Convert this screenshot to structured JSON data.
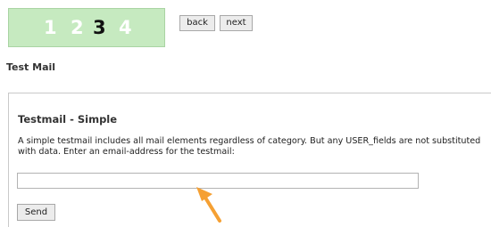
{
  "stepper": {
    "steps": [
      "1",
      "2",
      "3",
      "4"
    ],
    "active_step": "3",
    "colors": {
      "background": "#c6eac0",
      "inactive": "#ffffff",
      "active": "#111111"
    }
  },
  "nav": {
    "back_label": "back",
    "next_label": "next"
  },
  "page": {
    "title": "Test Mail"
  },
  "panel": {
    "title": "Testmail - Simple",
    "description": "A simple testmail includes all mail elements regardless of category. But any USER_fields are not substituted with data. Enter an email-address for the testmail:",
    "email_value": "",
    "send_label": "Send"
  },
  "annotation": {
    "icon": "arrow-pointer-icon",
    "color": "#f5a033"
  }
}
